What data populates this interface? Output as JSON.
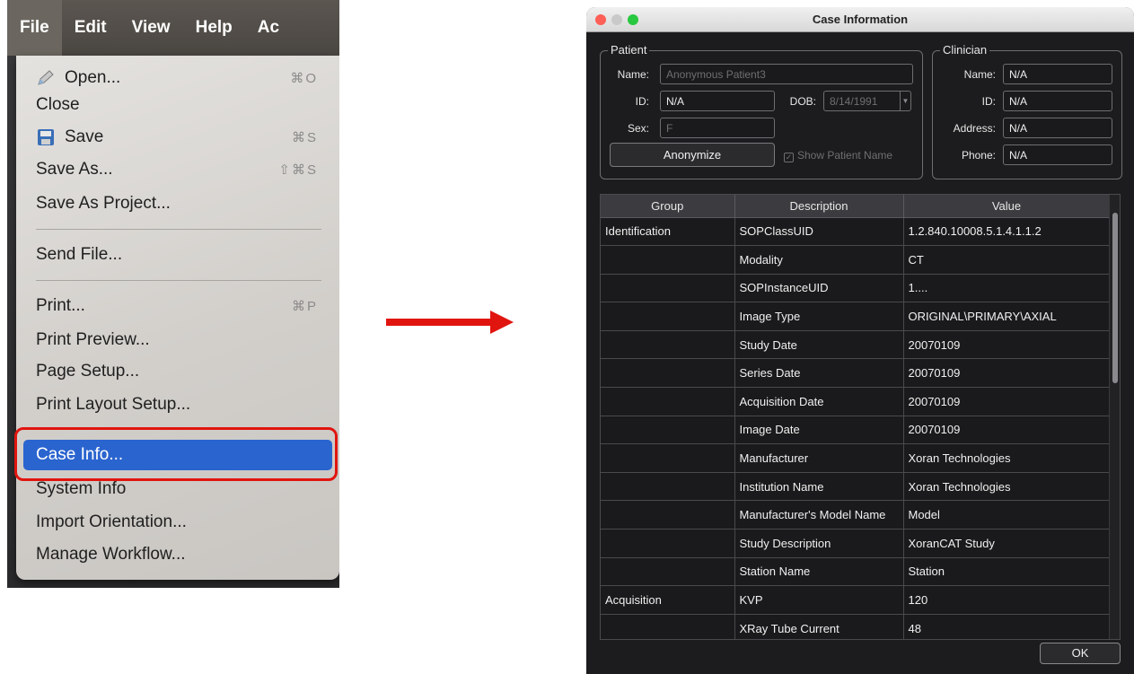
{
  "menubar": {
    "items": [
      "File",
      "Edit",
      "View",
      "Help",
      "Ac"
    ]
  },
  "file_menu": {
    "items": [
      {
        "label": "Open...",
        "shortcut": "⌘O"
      },
      {
        "label": "Close",
        "shortcut": ""
      },
      {
        "label": "Save",
        "shortcut": "⌘S"
      },
      {
        "label": "Save As...",
        "shortcut": "⇧⌘S"
      },
      {
        "label": "Save As Project...",
        "shortcut": ""
      },
      {
        "label": "Send File...",
        "shortcut": ""
      },
      {
        "label": "Print...",
        "shortcut": "⌘P"
      },
      {
        "label": "Print Preview...",
        "shortcut": ""
      },
      {
        "label": "Page Setup...",
        "shortcut": ""
      },
      {
        "label": "Print Layout Setup...",
        "shortcut": ""
      },
      {
        "label": "Case Info...",
        "shortcut": ""
      },
      {
        "label": "System Info",
        "shortcut": ""
      },
      {
        "label": "Import Orientation...",
        "shortcut": ""
      },
      {
        "label": "Manage Workflow...",
        "shortcut": ""
      }
    ],
    "selected": "Case Info...",
    "highlight_color": "#e1150f"
  },
  "arrow_color": "#e1150f",
  "dialog": {
    "title": "Case Information",
    "patient": {
      "legend": "Patient",
      "name_label": "Name:",
      "name_value": "Anonymous Patient3",
      "id_label": "ID:",
      "id_value": "N/A",
      "dob_label": "DOB:",
      "dob_value": "8/14/1991",
      "sex_label": "Sex:",
      "sex_value": "F",
      "anonymize_label": "Anonymize",
      "show_name_label": "Show Patient Name"
    },
    "clinician": {
      "legend": "Clinician",
      "name_label": "Name:",
      "name_value": "N/A",
      "id_label": "ID:",
      "id_value": "N/A",
      "address_label": "Address:",
      "address_value": "N/A",
      "phone_label": "Phone:",
      "phone_value": "N/A"
    },
    "table": {
      "headers": [
        "Group",
        "Description",
        "Value"
      ],
      "rows": [
        [
          "Identification",
          "SOPClassUID",
          "1.2.840.10008.5.1.4.1.1.2"
        ],
        [
          "",
          "Modality",
          "CT"
        ],
        [
          "",
          "SOPInstanceUID",
          "1...."
        ],
        [
          "",
          "Image Type",
          "ORIGINAL\\PRIMARY\\AXIAL"
        ],
        [
          "",
          "Study Date",
          "20070109"
        ],
        [
          "",
          "Series Date",
          "20070109"
        ],
        [
          "",
          "Acquisition Date",
          "20070109"
        ],
        [
          "",
          "Image Date",
          "20070109"
        ],
        [
          "",
          "Manufacturer",
          "Xoran Technologies"
        ],
        [
          "",
          "Institution Name",
          "Xoran Technologies"
        ],
        [
          "",
          "Manufacturer's Model Name",
          "Model"
        ],
        [
          "",
          "Study Description",
          "XoranCAT Study"
        ],
        [
          "",
          "Station Name",
          "Station"
        ],
        [
          "Acquisition",
          "KVP",
          "120"
        ],
        [
          "",
          "XRay Tube Current",
          "48"
        ]
      ]
    },
    "ok_label": "OK"
  }
}
